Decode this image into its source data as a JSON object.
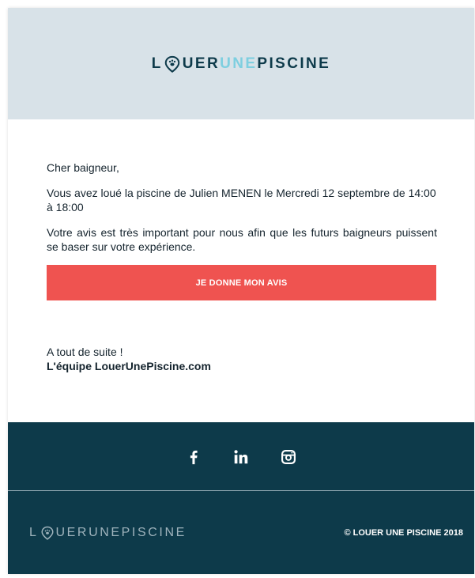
{
  "header": {
    "logo_prefix": "L",
    "logo_part1": "UER",
    "logo_part2": "UNE",
    "logo_part3": "PISCINE"
  },
  "colors": {
    "header_bg": "#d8e2e8",
    "dark_text": "#0d3a4a",
    "accent_teal": "#7ecfe0",
    "cta": "#ef5350",
    "footer_bg": "#0d3a4a",
    "footer_logo": "#9fb3bc"
  },
  "body": {
    "greeting": "Cher baigneur,",
    "para1": "Vous avez loué la piscine de Julien MENEN le Mercredi 12 septembre de 14:00 à 18:00",
    "para2": "Votre avis est très important pour nous afin que les futurs baigneurs puissent se baser sur votre expérience.",
    "cta_label": "JE DONNE MON AVIS",
    "signoff_line1": "A tout de suite !",
    "signoff_line2": "L'équipe LouerUnePiscine.com"
  },
  "footer": {
    "social_icons": [
      "facebook-icon",
      "linkedin-icon",
      "instagram-icon"
    ],
    "logo_prefix": "L",
    "logo_rest": "UERUNEPISCINE",
    "copyright": "© LOUER UNE PISCINE 2018"
  }
}
